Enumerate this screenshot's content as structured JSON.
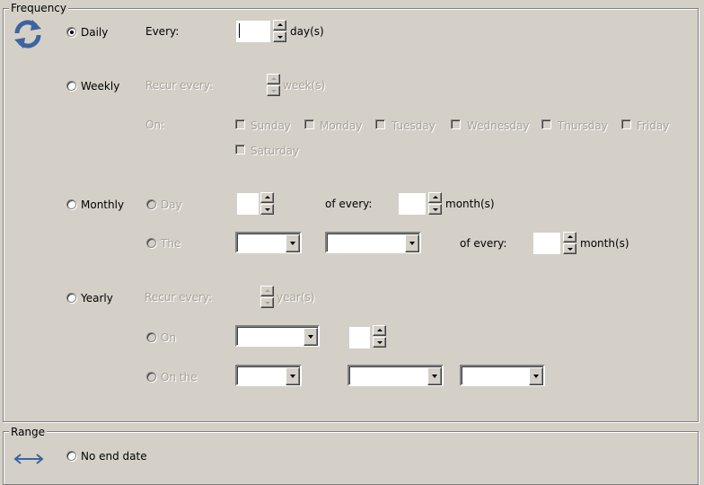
{
  "frequency": {
    "legend": "Frequency",
    "icon": "refresh-icon",
    "daily": {
      "label": "Daily",
      "checked": true,
      "every_label": "Every:",
      "every_value": "",
      "unit": "day(s)"
    },
    "weekly": {
      "label": "Weekly",
      "checked": false,
      "recur_label": "Recur every:",
      "unit": "week(s)",
      "on_label": "On:",
      "days": [
        "Sunday",
        "Monday",
        "Tuesday",
        "Wednesday",
        "Thursday",
        "Friday",
        "Saturday"
      ]
    },
    "monthly": {
      "label": "Monthly",
      "checked": false,
      "day_option": "Day",
      "day_value": "",
      "of_every_label": "of every:",
      "of_every_value": "",
      "unit": "month(s)",
      "the_option": "The",
      "the_of_every_label": "of every:",
      "the_of_every_value": "",
      "the_unit": "month(s)"
    },
    "yearly": {
      "label": "Yearly",
      "checked": false,
      "recur_label": "Recur every:",
      "unit": "year(s)",
      "on_option": "On",
      "on_the_option": "On the"
    }
  },
  "range": {
    "legend": "Range",
    "icon": "double-arrow-icon",
    "no_end_label": "No end date"
  }
}
